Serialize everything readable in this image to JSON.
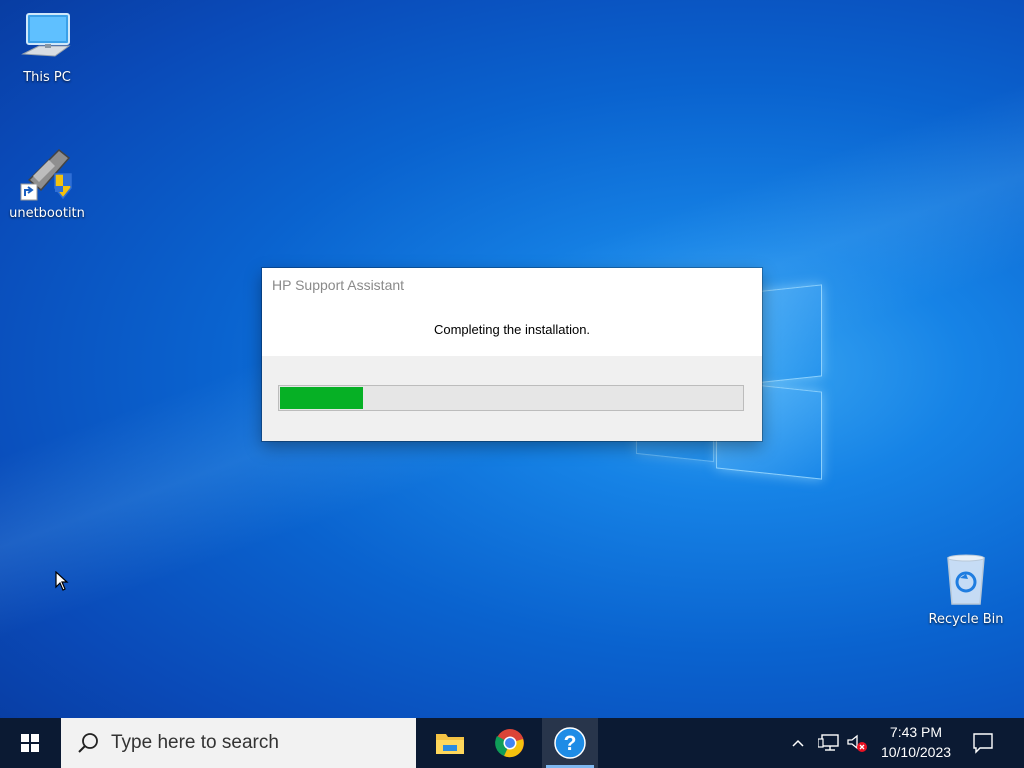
{
  "desktop": {
    "icons": [
      {
        "label": "This PC",
        "icon": "this-pc-icon"
      },
      {
        "label": "unetbootitn",
        "icon": "unetbootin-shortcut-icon"
      },
      {
        "label": "Recycle Bin",
        "icon": "recycle-bin-icon"
      }
    ]
  },
  "dialog": {
    "title": "HP Support Assistant",
    "message": "Completing the installation.",
    "progress_fraction": 0.18,
    "progress_color": "#06b025"
  },
  "taskbar": {
    "search_placeholder": "Type here to search",
    "apps": [
      {
        "name": "File Explorer",
        "icon": "file-explorer-icon"
      },
      {
        "name": "Google Chrome",
        "icon": "chrome-icon"
      },
      {
        "name": "HP Support Assistant",
        "icon": "help-question-icon",
        "active": true
      }
    ],
    "tray": {
      "time": "7:43 PM",
      "date": "10/10/2023",
      "icons": [
        "chevron-up-icon",
        "network-icon",
        "volume-muted-icon",
        "notification-icon"
      ]
    }
  },
  "colors": {
    "taskbar_bg": "#0b1a33",
    "desktop_accent": "#0a63cf"
  }
}
